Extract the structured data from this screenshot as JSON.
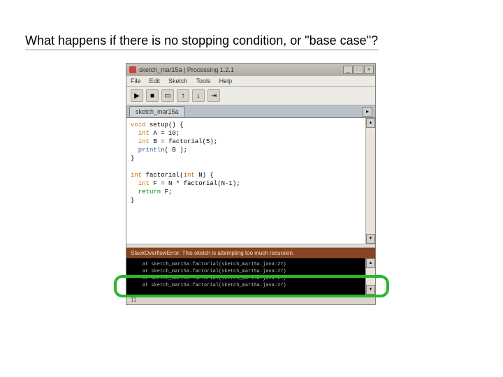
{
  "slide": {
    "title": "What happens if there is no stopping condition, or \"base case\"?"
  },
  "window": {
    "title_text": "sketch_mar15a | Processing 1.2.1",
    "min": "_",
    "max": "□",
    "close": "×"
  },
  "menu": {
    "file": "File",
    "edit": "Edit",
    "sketch": "Sketch",
    "tools": "Tools",
    "help": "Help"
  },
  "toolbar": {
    "run": "▶",
    "stop": "■",
    "new": "▭",
    "open": "↑",
    "save": "↓",
    "export": "⇥"
  },
  "tab": {
    "name": "sketch_mar15a",
    "arrow": "▸"
  },
  "code": {
    "l1a": "void",
    "l1b": " setup() {",
    "l2a": "  int",
    "l2b": " A = 10;",
    "l3a": "  int",
    "l3b": " B = factorial(5);",
    "l4a": "  println",
    "l4b": "( B );",
    "l5": "}",
    "l6": "",
    "l7a": "int",
    "l7b": " factorial(",
    "l7c": "int",
    "l7d": " N) {",
    "l8a": "  int",
    "l8b": " F = N * factorial(N-1);",
    "l9a": "  return",
    "l9b": " F;",
    "l10": "}"
  },
  "scroll": {
    "up": "▴",
    "down": "▾"
  },
  "error": {
    "banner": "StackOverflowError: This sketch is attempting too much recursion."
  },
  "console": {
    "l1": "    at sketch_mar15a.factorial(sketch_mar15a.java:27)",
    "l2": "    at sketch_mar15a.factorial(sketch_mar15a.java:27)",
    "l3": "    at sketch_mar15a.factorial(sketch_mar15a.java:27)",
    "l4": "    at sketch_mar15a.factorial(sketch_mar15a.java:27)"
  },
  "status": {
    "line": "11"
  }
}
